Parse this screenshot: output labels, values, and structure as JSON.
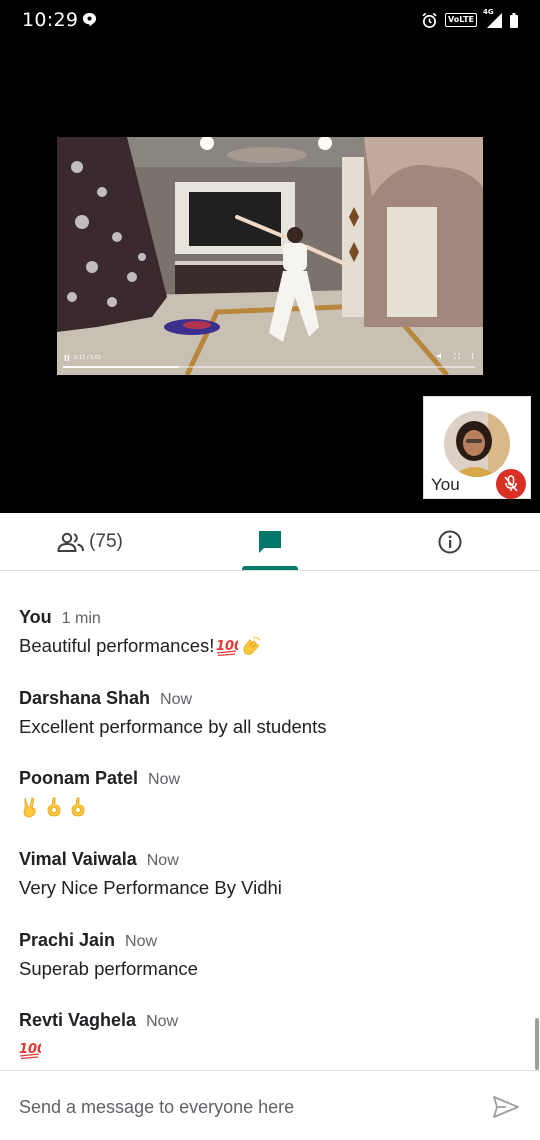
{
  "status_bar": {
    "time": "10:29",
    "volte_label": "VoLTE",
    "network_label": "4G"
  },
  "presentation": {
    "timestamp": "0:17 / 1:01",
    "progress": 0.28
  },
  "self_tile": {
    "label": "You",
    "mic_muted": true
  },
  "tabs": {
    "people_count": "(75)",
    "active": "chat"
  },
  "messages": [
    {
      "sender": "You",
      "time": "1 min",
      "text": "Beautiful performances!",
      "emojis": [
        "hundred-points",
        "clapping-hands"
      ]
    },
    {
      "sender": "Darshana Shah",
      "time": "Now",
      "text": "Excellent performance by all students",
      "emojis": []
    },
    {
      "sender": "Poonam Patel",
      "time": "Now",
      "text": "",
      "emojis": [
        "victory-hand",
        "ok-hand",
        "ok-hand"
      ]
    },
    {
      "sender": "Vimal Vaiwala",
      "time": "Now",
      "text": "Very Nice Performance By Vidhi",
      "emojis": []
    },
    {
      "sender": "Prachi Jain",
      "time": "Now",
      "text": "Superab performance",
      "emojis": []
    },
    {
      "sender": "Revti Vaghela",
      "time": "Now",
      "text": "",
      "emojis": [
        "hundred-points"
      ]
    }
  ],
  "composer": {
    "placeholder": "Send a message to everyone here"
  },
  "colors": {
    "accent": "#00796b",
    "mic_off": "#d93025",
    "text": "#202124",
    "muted_text": "#5f6368"
  }
}
